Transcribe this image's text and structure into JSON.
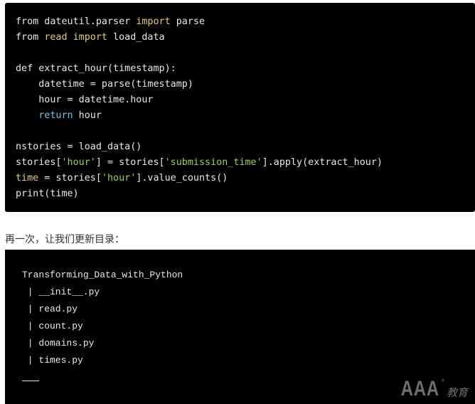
{
  "code_block_1": {
    "lines": [
      [
        {
          "t": "from dateutil.parser "
        },
        {
          "t": "import",
          "c": "kw-yellow"
        },
        {
          "t": " parse"
        }
      ],
      [
        {
          "t": "from "
        },
        {
          "t": "read",
          "c": "kw-yellow"
        },
        {
          "t": " "
        },
        {
          "t": "import",
          "c": "kw-yellow"
        },
        {
          "t": " load_data"
        }
      ],
      [
        {
          "t": ""
        }
      ],
      [
        {
          "t": "def extract_hour(timestamp):"
        }
      ],
      [
        {
          "t": "    datetime = parse(timestamp)"
        }
      ],
      [
        {
          "t": "    hour = datetime.hour"
        }
      ],
      [
        {
          "t": "    "
        },
        {
          "t": "return",
          "c": "kw-blue"
        },
        {
          "t": " hour"
        }
      ],
      [
        {
          "t": ""
        }
      ],
      [
        {
          "t": "nstories = load_data()"
        }
      ],
      [
        {
          "t": "stories["
        },
        {
          "t": "'hour'",
          "c": "str-green"
        },
        {
          "t": "] = stories["
        },
        {
          "t": "'submission_time'",
          "c": "str-green"
        },
        {
          "t": "].apply(extract_hour)"
        }
      ],
      [
        {
          "t": "time",
          "c": "kw-yellow"
        },
        {
          "t": " = stories["
        },
        {
          "t": "'hour'",
          "c": "str-green"
        },
        {
          "t": "].value_counts()"
        }
      ],
      [
        {
          "t": "print(time)"
        }
      ]
    ]
  },
  "paragraph": "再一次，让我们更新目录：",
  "code_block_2": {
    "root": "Transforming_Data_with_Python",
    "files": [
      " | __init__.py",
      " | read.py",
      " | count.py",
      " | domains.py",
      " | times.py"
    ]
  },
  "watermark": {
    "brand": "AAA",
    "registered": "®",
    "suffix": "教育"
  },
  "colors": {
    "code_bg": "#000000",
    "keyword_yellow": "#e6cd6a",
    "keyword_blue": "#66c8f0",
    "string_green": "#9ad43d",
    "code_text": "#e8e8e8"
  }
}
